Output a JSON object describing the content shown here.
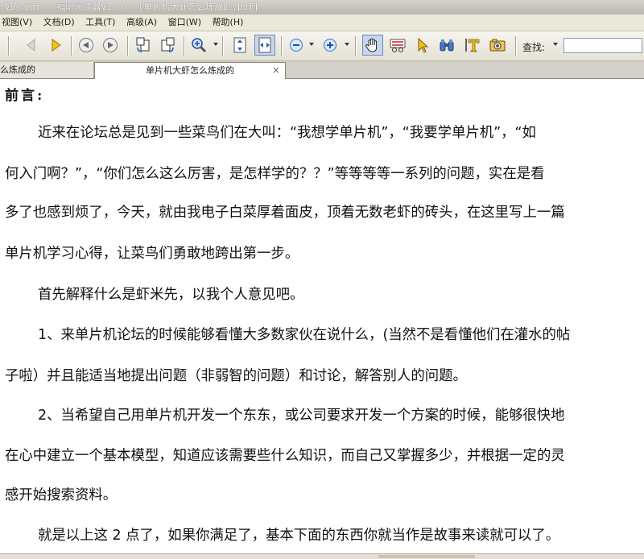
{
  "window": {
    "title": "成的.pdf - 福昕阅读器V3.0 - [单片机大虾怎么炼成的.pdf]"
  },
  "menu": {
    "items": [
      "视图(V)",
      "文档(D)",
      "工具(T)",
      "高级(A)",
      "窗口(W)",
      "帮助(H)"
    ]
  },
  "toolbar": {
    "search_label": "查找:",
    "search_value": ""
  },
  "tabs": [
    {
      "label": "么炼成的",
      "active": false
    },
    {
      "label": "单片机大虾怎么炼成的",
      "active": true,
      "close_glyph": "×"
    }
  ],
  "document": {
    "heading": "前言:",
    "lines": [
      "近来在论坛总是见到一些菜鸟们在大叫：“我想学单片机”，“我要学单片机”，“如",
      "何入门啊？”，“你们怎么这么厉害，是怎样学的？？”等等等等一系列的问题，实在是看",
      "多了也感到烦了，今天，就由我电子白菜厚着面皮，顶着无数老虾的砖头，在这里写上一篇",
      "单片机学习心得，让菜鸟们勇敢地跨出第一步。",
      "首先解释什么是虾米先，以我个人意见吧。",
      "1、来单片机论坛的时候能够看懂大多数家伙在说什么，(当然不是看懂他们在灌水的帖",
      "子啦）并且能适当地提出问题（非弱智的问题）和讨论，解答别人的问题。",
      "2、当希望自己用单片机开发一个东东，或公司要求开发一个方案的时候，能够很快地",
      "在心中建立一个基本模型，知道应该需要些什么知识，而自己又掌握多少，并根据一定的灵",
      "感开始搜索资料。",
      "就是以上这 2 点了，如果你满足了，基本下面的东西你就当作是故事来读就可以了。"
    ]
  }
}
